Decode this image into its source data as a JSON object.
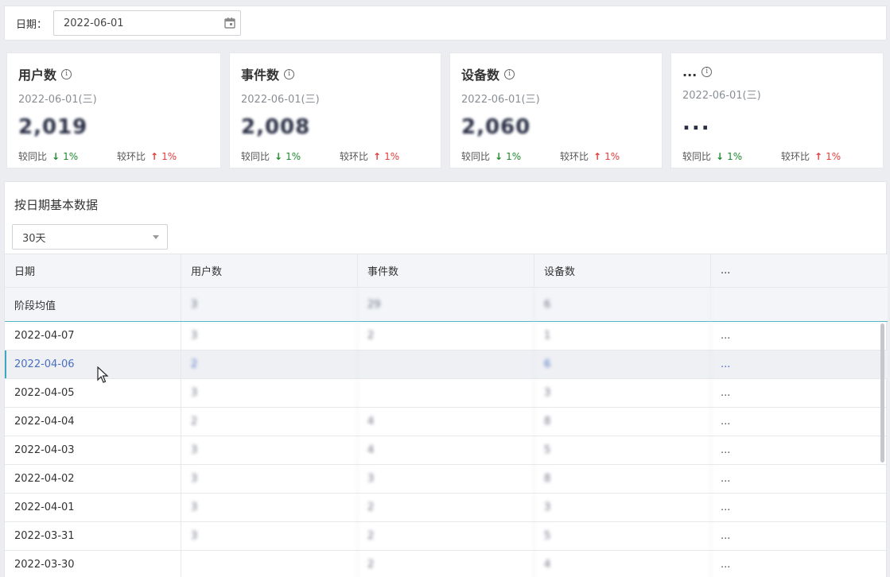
{
  "filter": {
    "date_label": "日期：",
    "date_value": "2022-06-01",
    "calendar_icon": "calendar-icon"
  },
  "cards": [
    {
      "title": "用户数",
      "date": "2022-06-01(三)",
      "value": "2,019",
      "yoy_label": "较同比",
      "yoy_dir": "down",
      "yoy_pct": "1%",
      "mom_label": "较环比",
      "mom_dir": "up",
      "mom_pct": "1%"
    },
    {
      "title": "事件数",
      "date": "2022-06-01(三)",
      "value": "2,008",
      "yoy_label": "较同比",
      "yoy_dir": "down",
      "yoy_pct": "1%",
      "mom_label": "较环比",
      "mom_dir": "up",
      "mom_pct": "1%"
    },
    {
      "title": "设备数",
      "date": "2022-06-01(三)",
      "value": "2,060",
      "yoy_label": "较同比",
      "yoy_dir": "down",
      "yoy_pct": "1%",
      "mom_label": "较环比",
      "mom_dir": "up",
      "mom_pct": "1%"
    },
    {
      "title": "...",
      "date": "2022-06-01(三)",
      "value": "...",
      "yoy_label": "较同比",
      "yoy_dir": "down",
      "yoy_pct": "1%",
      "mom_label": "较环比",
      "mom_dir": "up",
      "mom_pct": "1%"
    }
  ],
  "table": {
    "title": "按日期基本数据",
    "range_selected": "30天",
    "columns": [
      "日期",
      "用户数",
      "事件数",
      "设备数",
      "..."
    ],
    "average": [
      "阶段均值",
      "3",
      "29",
      "6",
      ""
    ],
    "rows": [
      [
        "2022-04-07",
        "3",
        "2",
        "1",
        "..."
      ],
      [
        "2022-04-06",
        "2",
        "",
        "6",
        "..."
      ],
      [
        "2022-04-05",
        "3",
        "",
        "3",
        "..."
      ],
      [
        "2022-04-04",
        "2",
        "4",
        "8",
        "..."
      ],
      [
        "2022-04-03",
        "3",
        "4",
        "5",
        "..."
      ],
      [
        "2022-04-02",
        "3",
        "3",
        "8",
        "..."
      ],
      [
        "2022-04-01",
        "3",
        "2",
        "3",
        "..."
      ],
      [
        "2022-03-31",
        "3",
        "2",
        "5",
        "..."
      ],
      [
        "2022-03-30",
        "",
        "2",
        "4",
        "..."
      ]
    ],
    "selected_row_index": 1
  }
}
